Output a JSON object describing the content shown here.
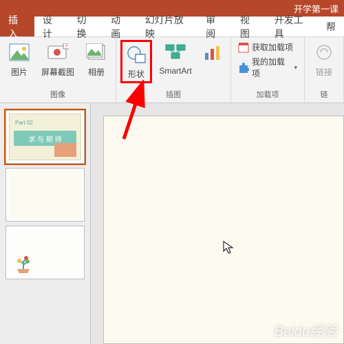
{
  "titlebar": {
    "title": "开学第一课"
  },
  "tabs": {
    "items": [
      {
        "label": "插入",
        "active": true
      },
      {
        "label": "设计"
      },
      {
        "label": "切换"
      },
      {
        "label": "动画"
      },
      {
        "label": "幻灯片放映"
      },
      {
        "label": "审阅"
      },
      {
        "label": "视图"
      },
      {
        "label": "开发工具"
      },
      {
        "label": "帮"
      }
    ]
  },
  "ribbon": {
    "groups": {
      "images": {
        "label": "图像",
        "buttons": {
          "picture": "图片",
          "screenshot": "屏幕截图",
          "album": "相册"
        }
      },
      "illustrations": {
        "label": "插图",
        "buttons": {
          "shapes": "形状",
          "smartart": "SmartArt",
          "chart": ""
        }
      },
      "addins": {
        "label": "加载项",
        "buttons": {
          "get": "获取加载项",
          "my": "我的加载项"
        }
      },
      "links": {
        "label": "链",
        "button": "链接"
      }
    }
  },
  "thumbs": {
    "slide1": {
      "part": "Part 02",
      "band": "求 与 期 待"
    }
  },
  "watermark": "Baidu经验"
}
